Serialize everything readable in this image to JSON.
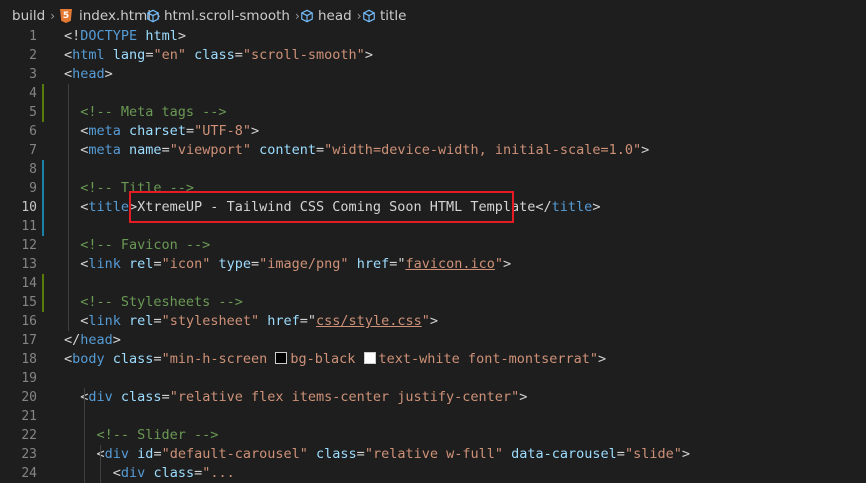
{
  "breadcrumb": [
    {
      "label": "build",
      "icon": "none"
    },
    {
      "label": "index.html",
      "icon": "html5-icon"
    },
    {
      "label": "html.scroll-smooth",
      "icon": "cube-icon"
    },
    {
      "label": "head",
      "icon": "cube-icon"
    },
    {
      "label": "title",
      "icon": "cube-icon"
    }
  ],
  "editor": {
    "active_line": 10,
    "lines": [
      {
        "n": 1,
        "tokens": [
          [
            "ent",
            "<!"
          ],
          [
            "tag",
            "DOCTYPE"
          ],
          [
            "ent",
            " "
          ],
          [
            "attr",
            "html"
          ],
          [
            "ent",
            ">"
          ]
        ]
      },
      {
        "n": 2,
        "tokens": [
          [
            "ent",
            "<"
          ],
          [
            "tag",
            "html"
          ],
          [
            "ent",
            " "
          ],
          [
            "attr",
            "lang"
          ],
          [
            "ent",
            "="
          ],
          [
            "str",
            "\"en\""
          ],
          [
            "ent",
            " "
          ],
          [
            "attr",
            "class"
          ],
          [
            "ent",
            "="
          ],
          [
            "str",
            "\"scroll-smooth\""
          ],
          [
            "ent",
            ">"
          ]
        ]
      },
      {
        "n": 3,
        "tokens": [
          [
            "ent",
            "<"
          ],
          [
            "tag",
            "head"
          ],
          [
            "ent",
            ">"
          ]
        ]
      },
      {
        "n": 4,
        "tokens": []
      },
      {
        "n": 5,
        "tokens": [
          [
            "ent",
            "  "
          ],
          [
            "com",
            "<!-- Meta tags -->"
          ]
        ]
      },
      {
        "n": 6,
        "tokens": [
          [
            "ent",
            "  <"
          ],
          [
            "tag",
            "meta"
          ],
          [
            "ent",
            " "
          ],
          [
            "attr",
            "charset"
          ],
          [
            "ent",
            "="
          ],
          [
            "str",
            "\"UTF-8\""
          ],
          [
            "ent",
            ">"
          ]
        ]
      },
      {
        "n": 7,
        "tokens": [
          [
            "ent",
            "  <"
          ],
          [
            "tag",
            "meta"
          ],
          [
            "ent",
            " "
          ],
          [
            "attr",
            "name"
          ],
          [
            "ent",
            "="
          ],
          [
            "str",
            "\"viewport\""
          ],
          [
            "ent",
            " "
          ],
          [
            "attr",
            "content"
          ],
          [
            "ent",
            "="
          ],
          [
            "str",
            "\"width=device-width, initial-scale=1.0\""
          ],
          [
            "ent",
            ">"
          ]
        ]
      },
      {
        "n": 8,
        "tokens": []
      },
      {
        "n": 9,
        "tokens": [
          [
            "ent",
            "  "
          ],
          [
            "com",
            "<!-- Title -->"
          ]
        ]
      },
      {
        "n": 10,
        "tokens": [
          [
            "ent",
            "  <"
          ],
          [
            "tag",
            "title"
          ],
          [
            "ent",
            ">XtremeUP - Tailwind CSS Coming Soon HTML Template</"
          ],
          [
            "tag",
            "title"
          ],
          [
            "ent",
            ">"
          ]
        ]
      },
      {
        "n": 11,
        "tokens": []
      },
      {
        "n": 12,
        "tokens": [
          [
            "ent",
            "  "
          ],
          [
            "com",
            "<!-- Favicon -->"
          ]
        ]
      },
      {
        "n": 13,
        "tokens": [
          [
            "ent",
            "  <"
          ],
          [
            "tag",
            "link"
          ],
          [
            "ent",
            " "
          ],
          [
            "attr",
            "rel"
          ],
          [
            "ent",
            "="
          ],
          [
            "str",
            "\"icon\""
          ],
          [
            "ent",
            " "
          ],
          [
            "attr",
            "type"
          ],
          [
            "ent",
            "="
          ],
          [
            "str",
            "\"image/png\""
          ],
          [
            "ent",
            " "
          ],
          [
            "attr",
            "href"
          ],
          [
            "ent",
            "=\""
          ],
          [
            "link",
            "favicon.ico"
          ],
          [
            "str",
            "\""
          ],
          [
            "ent",
            ">"
          ]
        ]
      },
      {
        "n": 14,
        "tokens": []
      },
      {
        "n": 15,
        "tokens": [
          [
            "ent",
            "  "
          ],
          [
            "com",
            "<!-- Stylesheets -->"
          ]
        ]
      },
      {
        "n": 16,
        "tokens": [
          [
            "ent",
            "  <"
          ],
          [
            "tag",
            "link"
          ],
          [
            "ent",
            " "
          ],
          [
            "attr",
            "rel"
          ],
          [
            "ent",
            "="
          ],
          [
            "str",
            "\"stylesheet\""
          ],
          [
            "ent",
            " "
          ],
          [
            "attr",
            "href"
          ],
          [
            "ent",
            "=\""
          ],
          [
            "link",
            "css/style.css"
          ],
          [
            "str",
            "\""
          ],
          [
            "ent",
            ">"
          ]
        ]
      },
      {
        "n": 17,
        "tokens": [
          [
            "ent",
            "</"
          ],
          [
            "tag",
            "head"
          ],
          [
            "ent",
            ">"
          ]
        ]
      },
      {
        "n": 18,
        "tokens": [
          [
            "ent",
            "<"
          ],
          [
            "tag",
            "body"
          ],
          [
            "ent",
            " "
          ],
          [
            "attr",
            "class"
          ],
          [
            "ent",
            "="
          ],
          [
            "str",
            "\"min-h-screen "
          ],
          [
            "swatch",
            "#000000"
          ],
          [
            "str",
            "bg-black "
          ],
          [
            "swatch",
            "#ffffff"
          ],
          [
            "str",
            "text-white font-montserrat\""
          ],
          [
            "ent",
            ">"
          ]
        ]
      },
      {
        "n": 19,
        "tokens": []
      },
      {
        "n": 20,
        "tokens": [
          [
            "ent",
            "  <"
          ],
          [
            "tag",
            "div"
          ],
          [
            "ent",
            " "
          ],
          [
            "attr",
            "class"
          ],
          [
            "ent",
            "="
          ],
          [
            "str",
            "\"relative flex items-center justify-center\""
          ],
          [
            "ent",
            ">"
          ]
        ]
      },
      {
        "n": 21,
        "tokens": []
      },
      {
        "n": 22,
        "tokens": [
          [
            "ent",
            "    "
          ],
          [
            "com",
            "<!-- Slider -->"
          ]
        ]
      },
      {
        "n": 23,
        "tokens": [
          [
            "ent",
            "    <"
          ],
          [
            "tag",
            "div"
          ],
          [
            "ent",
            " "
          ],
          [
            "attr",
            "id"
          ],
          [
            "ent",
            "="
          ],
          [
            "str",
            "\"default-carousel\""
          ],
          [
            "ent",
            " "
          ],
          [
            "attr",
            "class"
          ],
          [
            "ent",
            "="
          ],
          [
            "str",
            "\"relative w-full\""
          ],
          [
            "ent",
            " "
          ],
          [
            "attr",
            "data-carousel"
          ],
          [
            "ent",
            "="
          ],
          [
            "str",
            "\"slide\""
          ],
          [
            "ent",
            ">"
          ]
        ]
      },
      {
        "n": 24,
        "tokens": [
          [
            "ent",
            "      <"
          ],
          [
            "tag",
            "div"
          ],
          [
            "ent",
            " "
          ],
          [
            "attr",
            "class"
          ],
          [
            "ent",
            "="
          ],
          [
            "str",
            "\"..."
          ]
        ]
      }
    ]
  },
  "gutter_marks": [
    {
      "from": 4,
      "to": 5,
      "color": "#587c0c"
    },
    {
      "from": 8,
      "to": 11,
      "color": "#1b81a8"
    },
    {
      "from": 14,
      "to": 15,
      "color": "#587c0c"
    }
  ]
}
